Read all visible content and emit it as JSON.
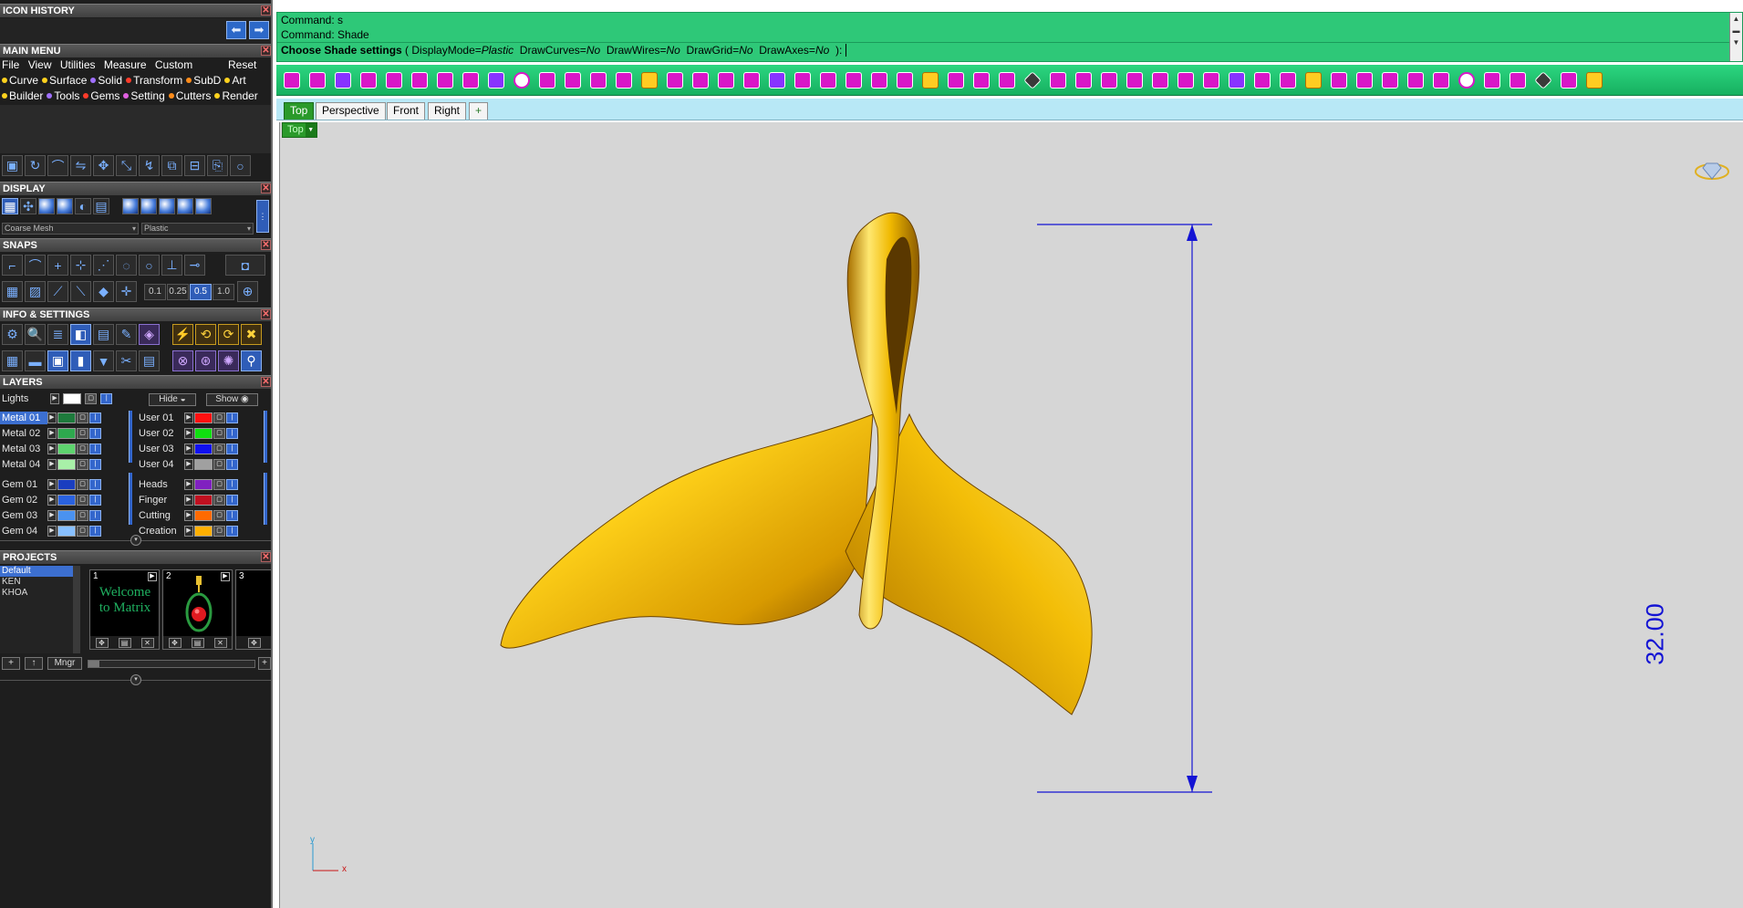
{
  "panels": {
    "icon_history": "ICON HISTORY",
    "main_menu": "MAIN MENU",
    "display": "DISPLAY",
    "snaps": "SNAPS",
    "info_settings": "INFO & SETTINGS",
    "layers": "LAYERS",
    "projects": "PROJECTS"
  },
  "menu": {
    "row1": [
      "File",
      "View",
      "Utilities",
      "Measure",
      "Custom"
    ],
    "reset": "Reset",
    "row2": [
      {
        "label": "Curve",
        "color": "#ffd21e"
      },
      {
        "label": "Surface",
        "color": "#ffd21e"
      },
      {
        "label": "Solid",
        "color": "#a070ff"
      },
      {
        "label": "Transform",
        "color": "#ff3b2a"
      },
      {
        "label": "SubD",
        "color": "#ff8c1a"
      },
      {
        "label": "Art",
        "color": "#ffd21e"
      }
    ],
    "row3": [
      {
        "label": "Builder",
        "color": "#ffd21e"
      },
      {
        "label": "Tools",
        "color": "#a070ff"
      },
      {
        "label": "Gems",
        "color": "#ff3b2a"
      },
      {
        "label": "Setting",
        "color": "#e060e0"
      },
      {
        "label": "Cutters",
        "color": "#ff8c1a"
      },
      {
        "label": "Render",
        "color": "#ffd21e"
      }
    ]
  },
  "display": {
    "mesh_option": "Coarse Mesh",
    "material_option": "Plastic"
  },
  "snaps": {
    "values": [
      "0.1",
      "0.25",
      "0.5",
      "1.0"
    ],
    "selected": "0.5"
  },
  "layers": {
    "lights": "Lights",
    "hide": "Hide",
    "show": "Show",
    "left": [
      {
        "name": "Metal 01",
        "color": "#1e7a3c",
        "selected": true
      },
      {
        "name": "Metal 02",
        "color": "#2ea84e"
      },
      {
        "name": "Metal 03",
        "color": "#5ed46e"
      },
      {
        "name": "Metal 04",
        "color": "#a8f0a8"
      },
      {
        "name": "Gem 01",
        "color": "#1a3ec0"
      },
      {
        "name": "Gem 02",
        "color": "#2a62e0"
      },
      {
        "name": "Gem 03",
        "color": "#4a92f0"
      },
      {
        "name": "Gem 04",
        "color": "#88c0ff"
      }
    ],
    "right": [
      {
        "name": "User 01",
        "color": "#ff1010"
      },
      {
        "name": "User 02",
        "color": "#10e010"
      },
      {
        "name": "User 03",
        "color": "#1010f0"
      },
      {
        "name": "User 04",
        "color": "#a0a0a0"
      },
      {
        "name": "Heads",
        "color": "#8020c0"
      },
      {
        "name": "Finger",
        "color": "#c01020"
      },
      {
        "name": "Cutting",
        "color": "#ff6a00"
      },
      {
        "name": "Creation",
        "color": "#ffb000"
      }
    ]
  },
  "projects": {
    "list": [
      "Default",
      "KEN",
      "KHOA"
    ],
    "selected": "Default",
    "thumbs": [
      {
        "num": "1",
        "caption": "Welcome to Matrix"
      },
      {
        "num": "2"
      },
      {
        "num": "3"
      }
    ],
    "mngr": "Mngr"
  },
  "command": {
    "line1": "Command: s",
    "line2": "Command: Shade",
    "prompt_title": "Choose Shade settings",
    "options": [
      {
        "key": "DisplayMode",
        "value": "Plastic"
      },
      {
        "key": "DrawCurves",
        "value": "No"
      },
      {
        "key": "DrawWires",
        "value": "No"
      },
      {
        "key": "DrawGrid",
        "value": "No"
      },
      {
        "key": "DrawAxes",
        "value": "No"
      }
    ]
  },
  "viewport_tabs": [
    "Top",
    "Perspective",
    "Front",
    "Right"
  ],
  "active_tab": "Top",
  "add_tab": "+",
  "viewport_label": "Top",
  "dimension": "32.00",
  "axes": {
    "x": "x",
    "y": "y"
  },
  "colors": {
    "accent_green": "#2ec878",
    "gold": "#f0c010",
    "dimension_blue": "#1414d4",
    "viewport_bg": "#d6d6d6"
  },
  "icons": {
    "nav_back": "arrow-left-icon",
    "nav_forward": "arrow-right-icon",
    "close": "close-icon",
    "jewel": "diamond-ring-icon"
  }
}
